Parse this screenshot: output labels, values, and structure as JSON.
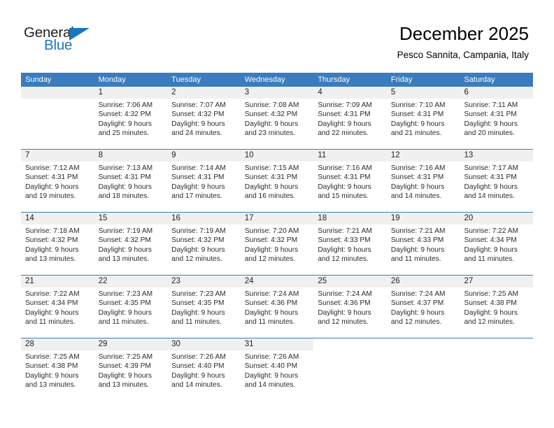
{
  "brand": {
    "name_top": "General",
    "name_bottom": "Blue",
    "accent_color": "#1878be",
    "text_color": "#231f20"
  },
  "header": {
    "title": "December 2025",
    "location": "Pesco Sannita, Campania, Italy"
  },
  "calendar": {
    "header_bg": "#3a7cbe",
    "daynum_bg": "#f0f0f0",
    "weekdays": [
      "Sunday",
      "Monday",
      "Tuesday",
      "Wednesday",
      "Thursday",
      "Friday",
      "Saturday"
    ],
    "weeks": [
      [
        {
          "day": "",
          "sunrise": "",
          "sunset": "",
          "daylight_line1": "",
          "daylight_line2": "",
          "empty": true
        },
        {
          "day": "1",
          "sunrise": "Sunrise: 7:06 AM",
          "sunset": "Sunset: 4:32 PM",
          "daylight_line1": "Daylight: 9 hours",
          "daylight_line2": "and 25 minutes."
        },
        {
          "day": "2",
          "sunrise": "Sunrise: 7:07 AM",
          "sunset": "Sunset: 4:32 PM",
          "daylight_line1": "Daylight: 9 hours",
          "daylight_line2": "and 24 minutes."
        },
        {
          "day": "3",
          "sunrise": "Sunrise: 7:08 AM",
          "sunset": "Sunset: 4:32 PM",
          "daylight_line1": "Daylight: 9 hours",
          "daylight_line2": "and 23 minutes."
        },
        {
          "day": "4",
          "sunrise": "Sunrise: 7:09 AM",
          "sunset": "Sunset: 4:31 PM",
          "daylight_line1": "Daylight: 9 hours",
          "daylight_line2": "and 22 minutes."
        },
        {
          "day": "5",
          "sunrise": "Sunrise: 7:10 AM",
          "sunset": "Sunset: 4:31 PM",
          "daylight_line1": "Daylight: 9 hours",
          "daylight_line2": "and 21 minutes."
        },
        {
          "day": "6",
          "sunrise": "Sunrise: 7:11 AM",
          "sunset": "Sunset: 4:31 PM",
          "daylight_line1": "Daylight: 9 hours",
          "daylight_line2": "and 20 minutes."
        }
      ],
      [
        {
          "day": "7",
          "sunrise": "Sunrise: 7:12 AM",
          "sunset": "Sunset: 4:31 PM",
          "daylight_line1": "Daylight: 9 hours",
          "daylight_line2": "and 19 minutes."
        },
        {
          "day": "8",
          "sunrise": "Sunrise: 7:13 AM",
          "sunset": "Sunset: 4:31 PM",
          "daylight_line1": "Daylight: 9 hours",
          "daylight_line2": "and 18 minutes."
        },
        {
          "day": "9",
          "sunrise": "Sunrise: 7:14 AM",
          "sunset": "Sunset: 4:31 PM",
          "daylight_line1": "Daylight: 9 hours",
          "daylight_line2": "and 17 minutes."
        },
        {
          "day": "10",
          "sunrise": "Sunrise: 7:15 AM",
          "sunset": "Sunset: 4:31 PM",
          "daylight_line1": "Daylight: 9 hours",
          "daylight_line2": "and 16 minutes."
        },
        {
          "day": "11",
          "sunrise": "Sunrise: 7:16 AM",
          "sunset": "Sunset: 4:31 PM",
          "daylight_line1": "Daylight: 9 hours",
          "daylight_line2": "and 15 minutes."
        },
        {
          "day": "12",
          "sunrise": "Sunrise: 7:16 AM",
          "sunset": "Sunset: 4:31 PM",
          "daylight_line1": "Daylight: 9 hours",
          "daylight_line2": "and 14 minutes."
        },
        {
          "day": "13",
          "sunrise": "Sunrise: 7:17 AM",
          "sunset": "Sunset: 4:31 PM",
          "daylight_line1": "Daylight: 9 hours",
          "daylight_line2": "and 14 minutes."
        }
      ],
      [
        {
          "day": "14",
          "sunrise": "Sunrise: 7:18 AM",
          "sunset": "Sunset: 4:32 PM",
          "daylight_line1": "Daylight: 9 hours",
          "daylight_line2": "and 13 minutes."
        },
        {
          "day": "15",
          "sunrise": "Sunrise: 7:19 AM",
          "sunset": "Sunset: 4:32 PM",
          "daylight_line1": "Daylight: 9 hours",
          "daylight_line2": "and 13 minutes."
        },
        {
          "day": "16",
          "sunrise": "Sunrise: 7:19 AM",
          "sunset": "Sunset: 4:32 PM",
          "daylight_line1": "Daylight: 9 hours",
          "daylight_line2": "and 12 minutes."
        },
        {
          "day": "17",
          "sunrise": "Sunrise: 7:20 AM",
          "sunset": "Sunset: 4:32 PM",
          "daylight_line1": "Daylight: 9 hours",
          "daylight_line2": "and 12 minutes."
        },
        {
          "day": "18",
          "sunrise": "Sunrise: 7:21 AM",
          "sunset": "Sunset: 4:33 PM",
          "daylight_line1": "Daylight: 9 hours",
          "daylight_line2": "and 12 minutes."
        },
        {
          "day": "19",
          "sunrise": "Sunrise: 7:21 AM",
          "sunset": "Sunset: 4:33 PM",
          "daylight_line1": "Daylight: 9 hours",
          "daylight_line2": "and 11 minutes."
        },
        {
          "day": "20",
          "sunrise": "Sunrise: 7:22 AM",
          "sunset": "Sunset: 4:34 PM",
          "daylight_line1": "Daylight: 9 hours",
          "daylight_line2": "and 11 minutes."
        }
      ],
      [
        {
          "day": "21",
          "sunrise": "Sunrise: 7:22 AM",
          "sunset": "Sunset: 4:34 PM",
          "daylight_line1": "Daylight: 9 hours",
          "daylight_line2": "and 11 minutes."
        },
        {
          "day": "22",
          "sunrise": "Sunrise: 7:23 AM",
          "sunset": "Sunset: 4:35 PM",
          "daylight_line1": "Daylight: 9 hours",
          "daylight_line2": "and 11 minutes."
        },
        {
          "day": "23",
          "sunrise": "Sunrise: 7:23 AM",
          "sunset": "Sunset: 4:35 PM",
          "daylight_line1": "Daylight: 9 hours",
          "daylight_line2": "and 11 minutes."
        },
        {
          "day": "24",
          "sunrise": "Sunrise: 7:24 AM",
          "sunset": "Sunset: 4:36 PM",
          "daylight_line1": "Daylight: 9 hours",
          "daylight_line2": "and 11 minutes."
        },
        {
          "day": "25",
          "sunrise": "Sunrise: 7:24 AM",
          "sunset": "Sunset: 4:36 PM",
          "daylight_line1": "Daylight: 9 hours",
          "daylight_line2": "and 12 minutes."
        },
        {
          "day": "26",
          "sunrise": "Sunrise: 7:24 AM",
          "sunset": "Sunset: 4:37 PM",
          "daylight_line1": "Daylight: 9 hours",
          "daylight_line2": "and 12 minutes."
        },
        {
          "day": "27",
          "sunrise": "Sunrise: 7:25 AM",
          "sunset": "Sunset: 4:38 PM",
          "daylight_line1": "Daylight: 9 hours",
          "daylight_line2": "and 12 minutes."
        }
      ],
      [
        {
          "day": "28",
          "sunrise": "Sunrise: 7:25 AM",
          "sunset": "Sunset: 4:38 PM",
          "daylight_line1": "Daylight: 9 hours",
          "daylight_line2": "and 13 minutes."
        },
        {
          "day": "29",
          "sunrise": "Sunrise: 7:25 AM",
          "sunset": "Sunset: 4:39 PM",
          "daylight_line1": "Daylight: 9 hours",
          "daylight_line2": "and 13 minutes."
        },
        {
          "day": "30",
          "sunrise": "Sunrise: 7:26 AM",
          "sunset": "Sunset: 4:40 PM",
          "daylight_line1": "Daylight: 9 hours",
          "daylight_line2": "and 14 minutes."
        },
        {
          "day": "31",
          "sunrise": "Sunrise: 7:26 AM",
          "sunset": "Sunset: 4:40 PM",
          "daylight_line1": "Daylight: 9 hours",
          "daylight_line2": "and 14 minutes."
        },
        {
          "day": "",
          "sunrise": "",
          "sunset": "",
          "daylight_line1": "",
          "daylight_line2": "",
          "blank": true
        },
        {
          "day": "",
          "sunrise": "",
          "sunset": "",
          "daylight_line1": "",
          "daylight_line2": "",
          "blank": true
        },
        {
          "day": "",
          "sunrise": "",
          "sunset": "",
          "daylight_line1": "",
          "daylight_line2": "",
          "blank": true
        }
      ]
    ]
  }
}
